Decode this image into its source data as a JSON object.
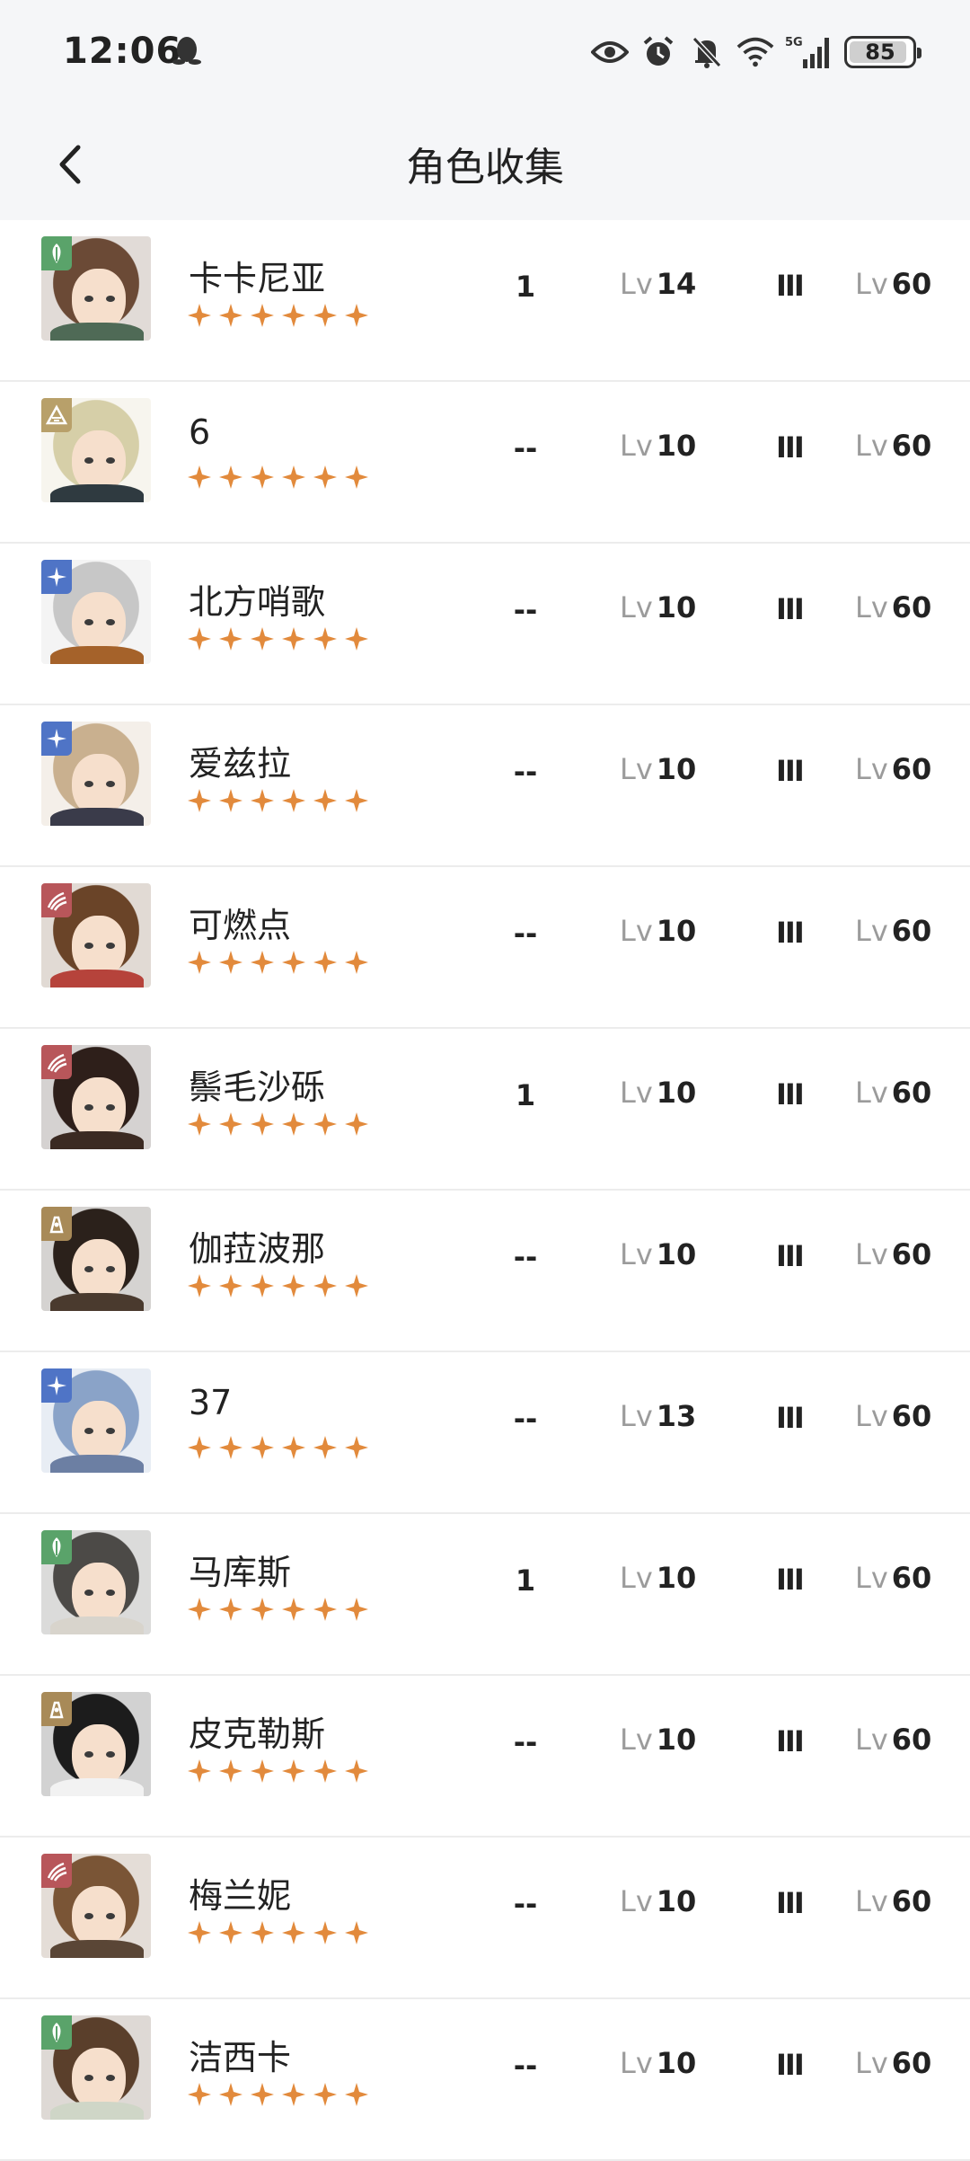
{
  "status_bar": {
    "time": "12:06",
    "network": "5G",
    "battery": "85",
    "icons": [
      "qq-penguin-icon",
      "eye-icon",
      "alarm-icon",
      "mute-bell-icon",
      "wifi-icon",
      "signal-icon",
      "battery-icon"
    ]
  },
  "header": {
    "title": "角色收集",
    "back_icon": "chevron-left-icon"
  },
  "colors": {
    "star": "#e28a3c",
    "nature": "#5aa36a",
    "earth": "#b8a06a",
    "star_type": "#4f74c6",
    "beast": "#b8565a",
    "spirit": "#a88a58"
  },
  "characters": [
    {
      "name": "卡卡尼亚",
      "afflatus": "nature",
      "col1": "1",
      "lv_label": "Lv",
      "level": "14",
      "tier": "III",
      "max_label": "Lv",
      "max_level": "60",
      "stars": 6,
      "hair": "#6b4a36",
      "outfit": "#4f6a56"
    },
    {
      "name": "6",
      "afflatus": "earth",
      "col1": "--",
      "lv_label": "Lv",
      "level": "10",
      "tier": "III",
      "max_label": "Lv",
      "max_level": "60",
      "stars": 6,
      "hair": "#d6cfa8",
      "outfit": "#2f3a40"
    },
    {
      "name": "北方哨歌",
      "afflatus": "star",
      "col1": "--",
      "lv_label": "Lv",
      "level": "10",
      "tier": "III",
      "max_label": "Lv",
      "max_level": "60",
      "stars": 6,
      "hair": "#c7c7c7",
      "outfit": "#a5622a"
    },
    {
      "name": "爱兹拉",
      "afflatus": "star",
      "col1": "--",
      "lv_label": "Lv",
      "level": "10",
      "tier": "III",
      "max_label": "Lv",
      "max_level": "60",
      "stars": 6,
      "hair": "#c9b08f",
      "outfit": "#3a3b4a"
    },
    {
      "name": "可燃点",
      "afflatus": "beast",
      "col1": "--",
      "lv_label": "Lv",
      "level": "10",
      "tier": "III",
      "max_label": "Lv",
      "max_level": "60",
      "stars": 6,
      "hair": "#6a4428",
      "outfit": "#b6433b"
    },
    {
      "name": "鬃毛沙砾",
      "afflatus": "beast",
      "col1": "1",
      "lv_label": "Lv",
      "level": "10",
      "tier": "III",
      "max_label": "Lv",
      "max_level": "60",
      "stars": 6,
      "hair": "#2e1f1a",
      "outfit": "#3b2a22"
    },
    {
      "name": "伽菈波那",
      "afflatus": "spirit",
      "col1": "--",
      "lv_label": "Lv",
      "level": "10",
      "tier": "III",
      "max_label": "Lv",
      "max_level": "60",
      "stars": 6,
      "hair": "#2b211b",
      "outfit": "#4a3a2e"
    },
    {
      "name": "37",
      "afflatus": "star",
      "col1": "--",
      "lv_label": "Lv",
      "level": "13",
      "tier": "III",
      "max_label": "Lv",
      "max_level": "60",
      "stars": 6,
      "hair": "#8aa3c8",
      "outfit": "#6c7fa3"
    },
    {
      "name": "马库斯",
      "afflatus": "nature",
      "col1": "1",
      "lv_label": "Lv",
      "level": "10",
      "tier": "III",
      "max_label": "Lv",
      "max_level": "60",
      "stars": 6,
      "hair": "#4c4a47",
      "outfit": "#d8d4cc"
    },
    {
      "name": "皮克勒斯",
      "afflatus": "spirit",
      "col1": "--",
      "lv_label": "Lv",
      "level": "10",
      "tier": "III",
      "max_label": "Lv",
      "max_level": "60",
      "stars": 6,
      "hair": "#1c1c1c",
      "outfit": "#f2f2f2"
    },
    {
      "name": "梅兰妮",
      "afflatus": "beast",
      "col1": "--",
      "lv_label": "Lv",
      "level": "10",
      "tier": "III",
      "max_label": "Lv",
      "max_level": "60",
      "stars": 6,
      "hair": "#7a5536",
      "outfit": "#5a4636"
    },
    {
      "name": "洁西卡",
      "afflatus": "nature",
      "col1": "--",
      "lv_label": "Lv",
      "level": "10",
      "tier": "III",
      "max_label": "Lv",
      "max_level": "60",
      "stars": 6,
      "hair": "#5a3f2b",
      "outfit": "#cfd6c7"
    }
  ]
}
